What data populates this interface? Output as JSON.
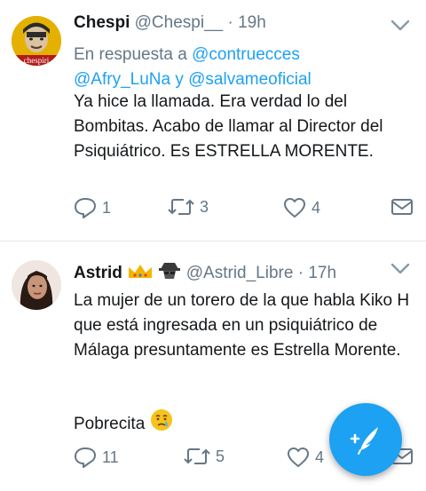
{
  "tweets": [
    {
      "name": "Chespi",
      "handle": "@Chespi__",
      "dot": "·",
      "time": "19h",
      "avatar_text": "chespiri",
      "reply_prefix": "En respuesta a",
      "reply_user1": "@contruecces",
      "reply_user2": "@Afry_LuNa",
      "reply_join": "y",
      "reply_user3": "@salvameoficial",
      "text": "Ya hice la llamada. Era verdad lo del Bombitas. Acabo de llamar al Director del Psiquiátrico. Es ESTRELLA MORENTE.",
      "replies": "1",
      "retweets": "3",
      "likes": "4"
    },
    {
      "name": "Astrid",
      "name_icons": [
        "crown-icon",
        "spy-icon"
      ],
      "handle": "@Astrid_Libre",
      "dot": "·",
      "time": "17h",
      "text": "La mujer de un torero de la que habla Kiko H que está ingresada en un psiquiátrico de Málaga presuntamente es Estrella Morente.",
      "text2": "Pobrecita",
      "text2_icon": "crying-face-emoji",
      "replies": "11",
      "retweets": "5",
      "likes": "4"
    }
  ],
  "colors": {
    "accent": "#1da1f2",
    "text_secondary": "#657786",
    "divider": "#e1e8ed"
  },
  "fab": {
    "icon": "compose-tweet-icon"
  }
}
